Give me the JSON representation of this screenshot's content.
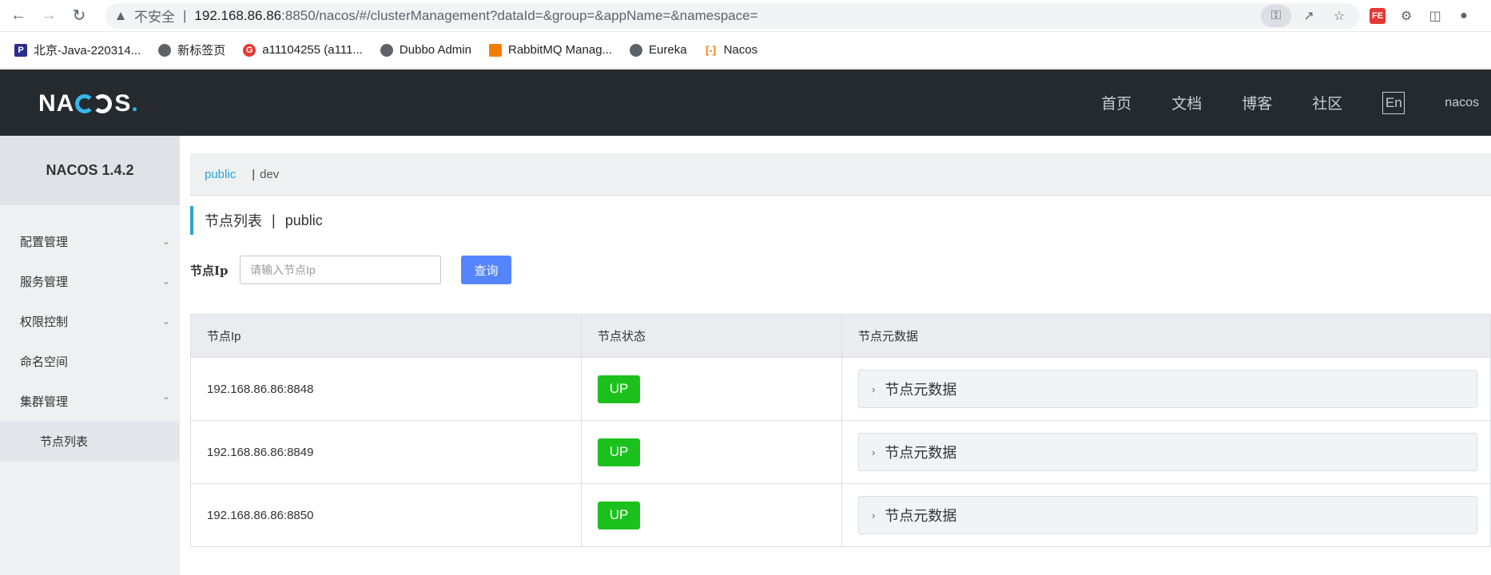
{
  "browser": {
    "insecure_label": "不安全",
    "url_host": "192.168.86.86",
    "url_path": ":8850/nacos/#/clusterManagement?dataId=&group=&appName=&namespace=",
    "bookmarks": [
      {
        "label": "北京-Java-220314...",
        "icon": "p-icon"
      },
      {
        "label": "新标签页",
        "icon": "globe-icon"
      },
      {
        "label": "a11104255 (a111...",
        "icon": "g-icon"
      },
      {
        "label": "Dubbo Admin",
        "icon": "globe-icon"
      },
      {
        "label": "RabbitMQ Manag...",
        "icon": "rabbitmq-icon"
      },
      {
        "label": "Eureka",
        "icon": "globe-icon"
      },
      {
        "label": "Nacos",
        "icon": "nacos-icon"
      }
    ]
  },
  "header": {
    "logo_left": "NA",
    "logo_right": "S",
    "nav": [
      "首页",
      "文档",
      "博客",
      "社区"
    ],
    "lang": "En",
    "user": "nacos"
  },
  "sidebar": {
    "title": "NACOS 1.4.2",
    "items": [
      {
        "label": "配置管理",
        "chevron": "down"
      },
      {
        "label": "服务管理",
        "chevron": "down"
      },
      {
        "label": "权限控制",
        "chevron": "down"
      },
      {
        "label": "命名空间",
        "chevron": ""
      },
      {
        "label": "集群管理",
        "chevron": "up"
      }
    ],
    "sub_item": "节点列表"
  },
  "namespace": {
    "active": "public",
    "sep": "|",
    "other": "dev"
  },
  "page": {
    "title": "节点列表",
    "sep": "|",
    "namespace": "public"
  },
  "search": {
    "label": "节点Ip",
    "placeholder": "请输入节点Ip",
    "button": "查询"
  },
  "table": {
    "headers": [
      "节点Ip",
      "节点状态",
      "节点元数据"
    ],
    "rows": [
      {
        "ip": "192.168.86.86:8848",
        "state": "UP",
        "meta": "节点元数据"
      },
      {
        "ip": "192.168.86.86:8849",
        "state": "UP",
        "meta": "节点元数据"
      },
      {
        "ip": "192.168.86.86:8850",
        "state": "UP",
        "meta": "节点元数据"
      }
    ]
  },
  "colors": {
    "header_bg": "#252a2f",
    "accent": "#29a5d4",
    "button": "#5584ff",
    "up_badge": "#1dc11d"
  }
}
